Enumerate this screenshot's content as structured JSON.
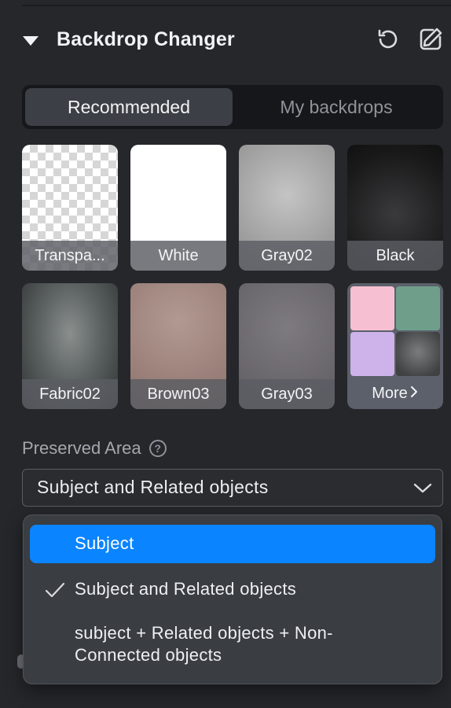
{
  "panel": {
    "title": "Backdrop Changer",
    "reset_icon": "reset-icon",
    "edit_icon": "edit-pencil-icon",
    "collapse_icon": "triangle-down-icon"
  },
  "tabs": [
    {
      "label": "Recommended",
      "active": true
    },
    {
      "label": "My backdrops",
      "active": false
    }
  ],
  "backdrops": [
    {
      "label": "Transpa..."
    },
    {
      "label": "White"
    },
    {
      "label": "Gray02"
    },
    {
      "label": "Black"
    },
    {
      "label": "Fabric02"
    },
    {
      "label": "Brown03"
    },
    {
      "label": "Gray03"
    },
    {
      "label": "More"
    }
  ],
  "preserved_area": {
    "label": "Preserved Area",
    "help_icon": "question-circle-icon",
    "selected": "Subject and Related objects"
  },
  "dropdown": {
    "options": [
      {
        "label": "Subject",
        "highlighted": true,
        "checked": false
      },
      {
        "label": "Subject and Related objects",
        "highlighted": false,
        "checked": true
      },
      {
        "label": "subject + Related objects + Non-Connected objects",
        "highlighted": false,
        "checked": false
      }
    ]
  },
  "colors": {
    "accent": "#0a84ff",
    "panel_bg": "#25272b",
    "menu_bg": "#3a3d42"
  }
}
